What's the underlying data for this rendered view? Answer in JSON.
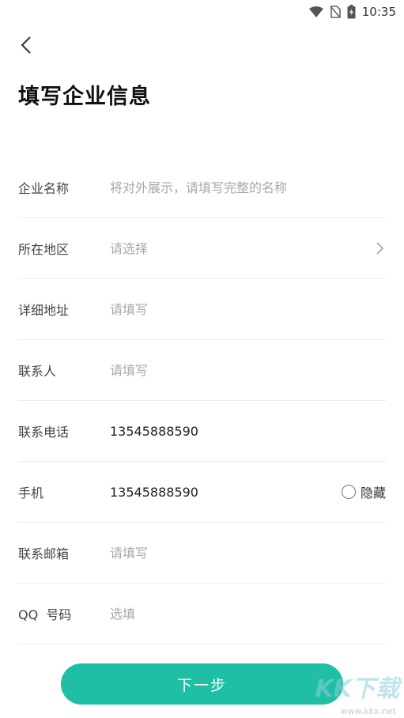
{
  "status_bar": {
    "time": "10:35",
    "icons": [
      "wifi-icon",
      "no-sim-icon",
      "battery-charging-icon"
    ]
  },
  "header": {
    "back_icon": "chevron-left-icon",
    "title": "填写企业信息"
  },
  "form": {
    "company_name": {
      "label": "企业名称",
      "placeholder": "将对外展示，请填写完整的名称",
      "value": ""
    },
    "region": {
      "label": "所在地区",
      "placeholder": "请选择",
      "value": ""
    },
    "address": {
      "label": "详细地址",
      "placeholder": "请填写",
      "value": ""
    },
    "contact": {
      "label": "联系人",
      "placeholder": "请填写",
      "value": ""
    },
    "contact_phone": {
      "label": "联系电话",
      "placeholder": "",
      "value": "13545888590"
    },
    "mobile": {
      "label": "手机",
      "placeholder": "",
      "value": "13545888590",
      "hide_label": "隐藏",
      "hide_checked": false
    },
    "email": {
      "label": "联系邮箱",
      "placeholder": "请填写",
      "value": ""
    },
    "qq": {
      "label": "QQ  号码",
      "placeholder": "选填",
      "value": ""
    }
  },
  "actions": {
    "next_label": "下一步"
  },
  "colors": {
    "accent": "#1ebfa4",
    "placeholder": "#a8a8a8",
    "divider": "#ececec"
  },
  "watermark": {
    "logo_text": "KK下载",
    "url": "www.kkx.net"
  }
}
